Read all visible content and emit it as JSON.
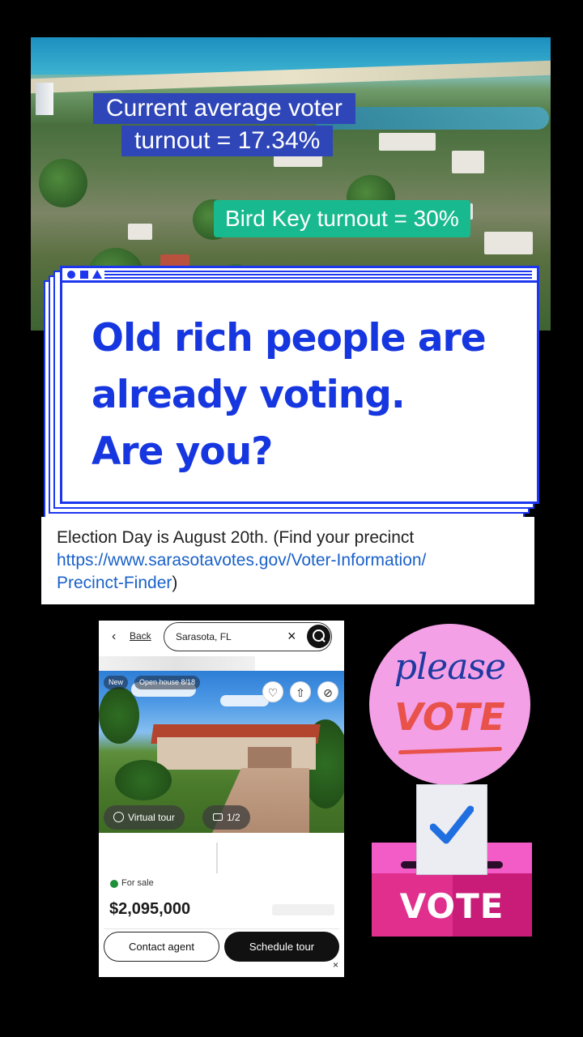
{
  "aerial": {
    "overlay_blue_line1": "Current average voter",
    "overlay_blue_line2": "turnout = 17.34%",
    "overlay_green": "Bird Key turnout = 30%"
  },
  "card": {
    "headline_line1": "Old rich people are",
    "headline_line2": "already voting.",
    "headline_line3": "Are you?"
  },
  "info": {
    "text_prefix": "Election Day is August 20th. (Find your precinct",
    "link_line1": "https://www.sarasotavotes.gov/Voter-Information/",
    "link_line2": "Precinct-Finder",
    "text_suffix": ")"
  },
  "listing": {
    "back_label": "Back",
    "search_value": "Sarasota, FL",
    "tag_new": "New",
    "tag_open_house": "Open house 8/18",
    "virtual_tour_label": "Virtual tour",
    "photo_count": "1/2",
    "status_label": "For sale",
    "status_color": "#1f8f3a",
    "price": "$2,095,000",
    "contact_label": "Contact agent",
    "schedule_label": "Schedule tour",
    "icons": [
      "back-chevron-icon",
      "close-icon",
      "search-icon",
      "heart-icon",
      "share-icon",
      "hide-icon",
      "globe-icon",
      "camera-icon"
    ]
  },
  "sticker": {
    "please": "please",
    "vote": "VOTE"
  },
  "ballot_box": {
    "label": "VOTE",
    "colors": {
      "box_light": "#f35bc6",
      "box_dark": "#e02f8d",
      "check": "#1f6fe0"
    }
  },
  "colors": {
    "headline_blue": "#1636e0",
    "overlay_blue": "#2f46b8",
    "overlay_green": "#19b98f",
    "link": "#1a61c9"
  }
}
